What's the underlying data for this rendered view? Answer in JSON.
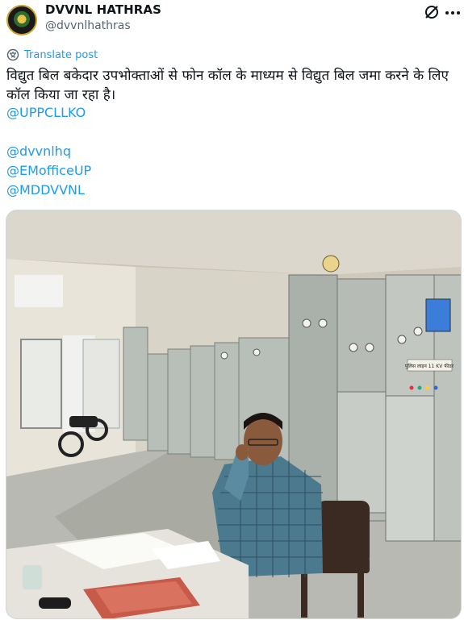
{
  "account": {
    "display_name": "DVVNL HATHRAS",
    "handle": "@dvvnlhathras",
    "avatar_icon": "dvvnl-logo-avatar"
  },
  "actions": {
    "grok_icon": "grok-icon",
    "more_icon": "more-horizontal-icon"
  },
  "translate": {
    "label": "Translate post",
    "icon": "translate-icon"
  },
  "post": {
    "text": "विद्युत बिल बकेदार उपभोक्ताओं से फोन कॉल के माध्यम से विद्युत बिल जमा करने के लिए कॉल किया जा रहा है।",
    "mentions": [
      "@UPPCLLKO",
      "@dvvnlhq",
      "@EMofficeUP",
      "@MDDVVNL"
    ]
  },
  "media": {
    "panel_labels": [
      "पुलिस लाइन 11 KV फीडर"
    ],
    "colors": {
      "link": "#1d9bf0",
      "muted": "#536471"
    }
  }
}
